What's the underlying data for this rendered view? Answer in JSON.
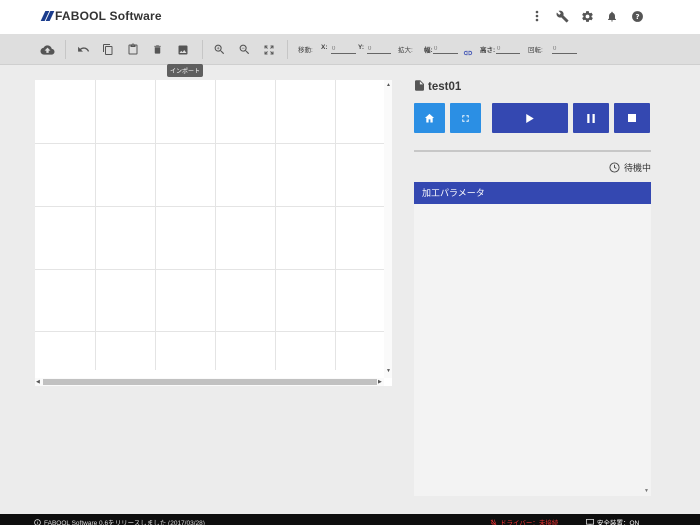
{
  "header": {
    "app_title": "FABOOL Software",
    "icons": [
      "more-vert-icon",
      "wrench-icon",
      "gear-icon",
      "bell-icon",
      "help-icon"
    ]
  },
  "toolbar": {
    "buttons": [
      "upload-icon",
      "undo-icon",
      "copy-icon",
      "paste-icon",
      "delete-icon",
      "import-image-icon",
      "zoom-in-icon",
      "zoom-out-icon",
      "fit-screen-icon"
    ],
    "move_label": "移動:",
    "x_label": "X:",
    "x_value": "0",
    "y_label": "Y:",
    "y_value": "0",
    "scale_label": "拡大:",
    "width_label": "幅:",
    "width_value": "0",
    "height_label": "高さ:",
    "height_value": "0",
    "rotate_label": "回転:",
    "rotate_value": "0",
    "tooltip": "インポート"
  },
  "panel": {
    "file_name": "test01",
    "controls": [
      "home-icon",
      "frame-icon",
      "play-icon",
      "pause-icon",
      "stop-icon"
    ],
    "status": "待機中",
    "params_title": "加工パラメータ"
  },
  "footer": {
    "news": "FABOOL Software 0.6をリリースしました (2017/03/28)",
    "driver_status": "ドライバー：未接続",
    "safety_label": "安全装置：ON"
  },
  "colors": {
    "primary_dark": "#3448b1",
    "primary_light": "#2b8fe4",
    "footer_bg": "#0e0e0e",
    "error": "#e33333"
  }
}
